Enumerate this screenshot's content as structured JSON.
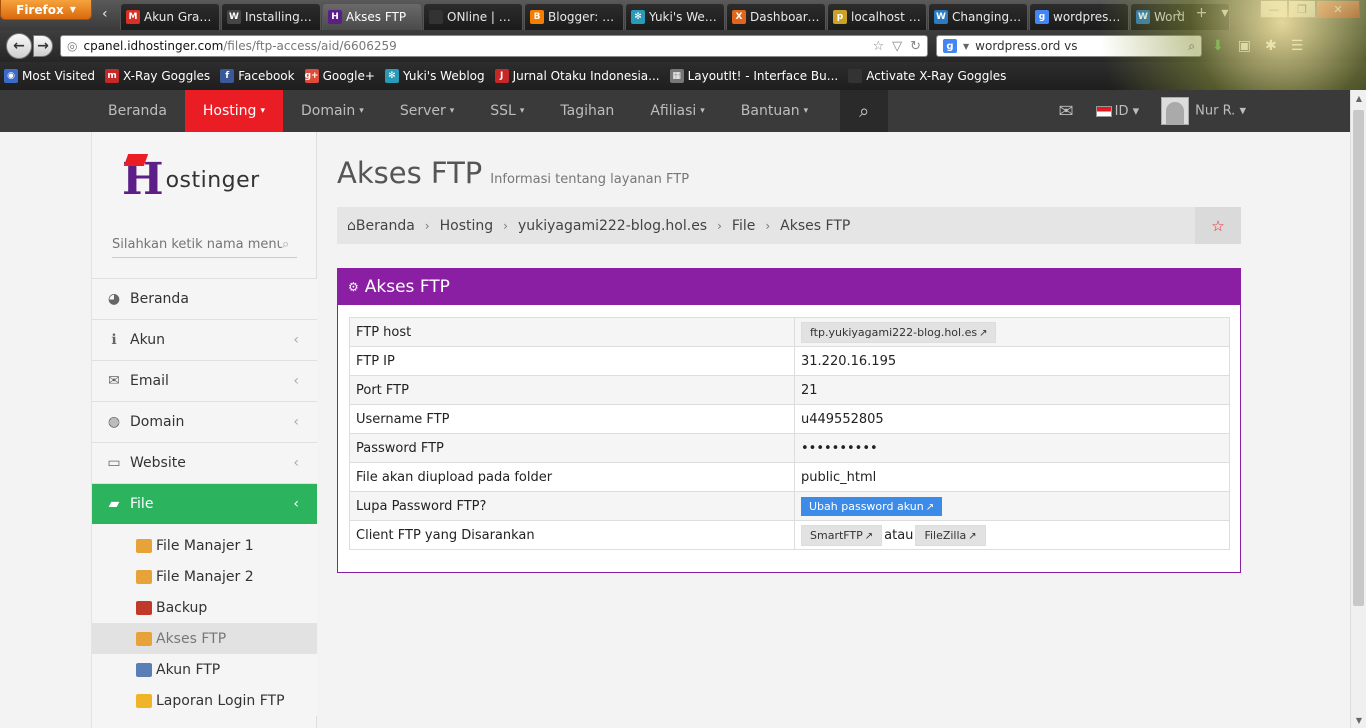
{
  "browser": {
    "app_button": "Firefox",
    "tabs": [
      {
        "label": "Akun Gratis ...",
        "icon": "M",
        "color": "#d93025",
        "active": false
      },
      {
        "label": "Installing W...",
        "icon": "W",
        "color": "#464646",
        "active": false
      },
      {
        "label": "Akses FTP",
        "icon": "H",
        "color": "#5b1f87",
        "active": true
      },
      {
        "label": "ONline | Ho...",
        "icon": "",
        "color": "#333333",
        "active": false
      },
      {
        "label": "Blogger: Yu...",
        "icon": "B",
        "color": "#f57d00",
        "active": false
      },
      {
        "label": "Yuki's Webl...",
        "icon": "✻",
        "color": "#2a9ab8",
        "active": false
      },
      {
        "label": "Dashboard ‹...",
        "icon": "X",
        "color": "#e0661b",
        "active": false
      },
      {
        "label": "localhost / l...",
        "icon": "p",
        "color": "#c9a227",
        "active": false
      },
      {
        "label": "Changing a ...",
        "icon": "W",
        "color": "#2a7bbf",
        "active": false
      },
      {
        "label": "wordpress.o...",
        "icon": "g",
        "color": "#4285f4",
        "active": false
      },
      {
        "label": "Word",
        "icon": "W",
        "color": "#2a7bbf",
        "active": false
      }
    ],
    "url_host": "cpanel.idhostinger.com",
    "url_path": "/files/ftp-access/aid/6606259",
    "url_prefix": "",
    "search_value": "wordpress.ord vs",
    "bookmarks": [
      {
        "label": "Most Visited",
        "icon": "◉",
        "color": "#3a6bc8"
      },
      {
        "label": "X-Ray Goggles",
        "icon": "m",
        "color": "#c62828"
      },
      {
        "label": "Facebook",
        "icon": "f",
        "color": "#3b5998"
      },
      {
        "label": "Google+",
        "icon": "g+",
        "color": "#dd4b39"
      },
      {
        "label": "Yuki's Weblog",
        "icon": "✻",
        "color": "#2a9ab8"
      },
      {
        "label": "Jurnal Otaku Indonesia...",
        "icon": "J",
        "color": "#c62828"
      },
      {
        "label": "LayoutIt! - Interface Bu...",
        "icon": "▦",
        "color": "#777777"
      },
      {
        "label": "Activate X-Ray Goggles",
        "icon": "",
        "color": "#333333"
      }
    ]
  },
  "topnav": {
    "items": [
      {
        "label": "Beranda",
        "chevron": false,
        "active": false
      },
      {
        "label": "Hosting",
        "chevron": true,
        "active": true
      },
      {
        "label": "Domain",
        "chevron": true,
        "active": false
      },
      {
        "label": "Server",
        "chevron": true,
        "active": false
      },
      {
        "label": "SSL",
        "chevron": true,
        "active": false
      },
      {
        "label": "Tagihan",
        "chevron": false,
        "active": false
      },
      {
        "label": "Afiliasi",
        "chevron": true,
        "active": false
      },
      {
        "label": "Bantuan",
        "chevron": true,
        "active": false
      }
    ],
    "lang": "ID",
    "user": "Nur R."
  },
  "sidebar": {
    "logo_h": "H",
    "logo_rest": "ostinger",
    "search_placeholder": "Silahkan ketik nama menu",
    "menu": [
      {
        "label": "Beranda",
        "icon": "◕",
        "arrow": false,
        "active": false
      },
      {
        "label": "Akun",
        "icon": "ℹ",
        "arrow": true,
        "active": false
      },
      {
        "label": "Email",
        "icon": "✉",
        "arrow": true,
        "active": false
      },
      {
        "label": "Domain",
        "icon": "◍",
        "arrow": true,
        "active": false
      },
      {
        "label": "Website",
        "icon": "▭",
        "arrow": true,
        "active": false
      },
      {
        "label": "File",
        "icon": "▰",
        "arrow": true,
        "active": true
      }
    ],
    "submenu": [
      {
        "label": "File Manajer 1",
        "color": "#e8a23a",
        "active": false
      },
      {
        "label": "File Manajer 2",
        "color": "#e8a23a",
        "active": false
      },
      {
        "label": "Backup",
        "color": "#c0392b",
        "active": false
      },
      {
        "label": "Akses FTP",
        "color": "#e8a23a",
        "active": true
      },
      {
        "label": "Akun FTP",
        "color": "#5a7fb5",
        "active": false
      },
      {
        "label": "Laporan Login FTP",
        "color": "#f0b429",
        "active": false
      }
    ]
  },
  "main": {
    "title": "Akses FTP",
    "subtitle": "Informasi tentang layanan FTP",
    "breadcrumb": [
      "Beranda",
      "Hosting",
      "yukiyagami222-blog.hol.es",
      "File",
      "Akses FTP"
    ],
    "panel_title": "Akses FTP",
    "rows": [
      {
        "key": "FTP host",
        "value": "ftp.yukiyagami222-blog.hol.es",
        "kind": "tag"
      },
      {
        "key": "FTP IP",
        "value": "31.220.16.195",
        "kind": "text"
      },
      {
        "key": "Port FTP",
        "value": "21",
        "kind": "text"
      },
      {
        "key": "Username FTP",
        "value": "u449552805",
        "kind": "text"
      },
      {
        "key": "Password FTP",
        "value": "••••••••••",
        "kind": "text"
      },
      {
        "key": "File akan diupload pada folder",
        "value": "public_html",
        "kind": "text"
      },
      {
        "key": "Lupa Password FTP?",
        "value": "Ubah password akun",
        "kind": "button"
      },
      {
        "key": "Client FTP yang Disarankan",
        "value": "",
        "kind": "clients"
      }
    ],
    "clients": [
      "SmartFTP",
      "FileZilla"
    ],
    "clients_joiner": "atau"
  }
}
